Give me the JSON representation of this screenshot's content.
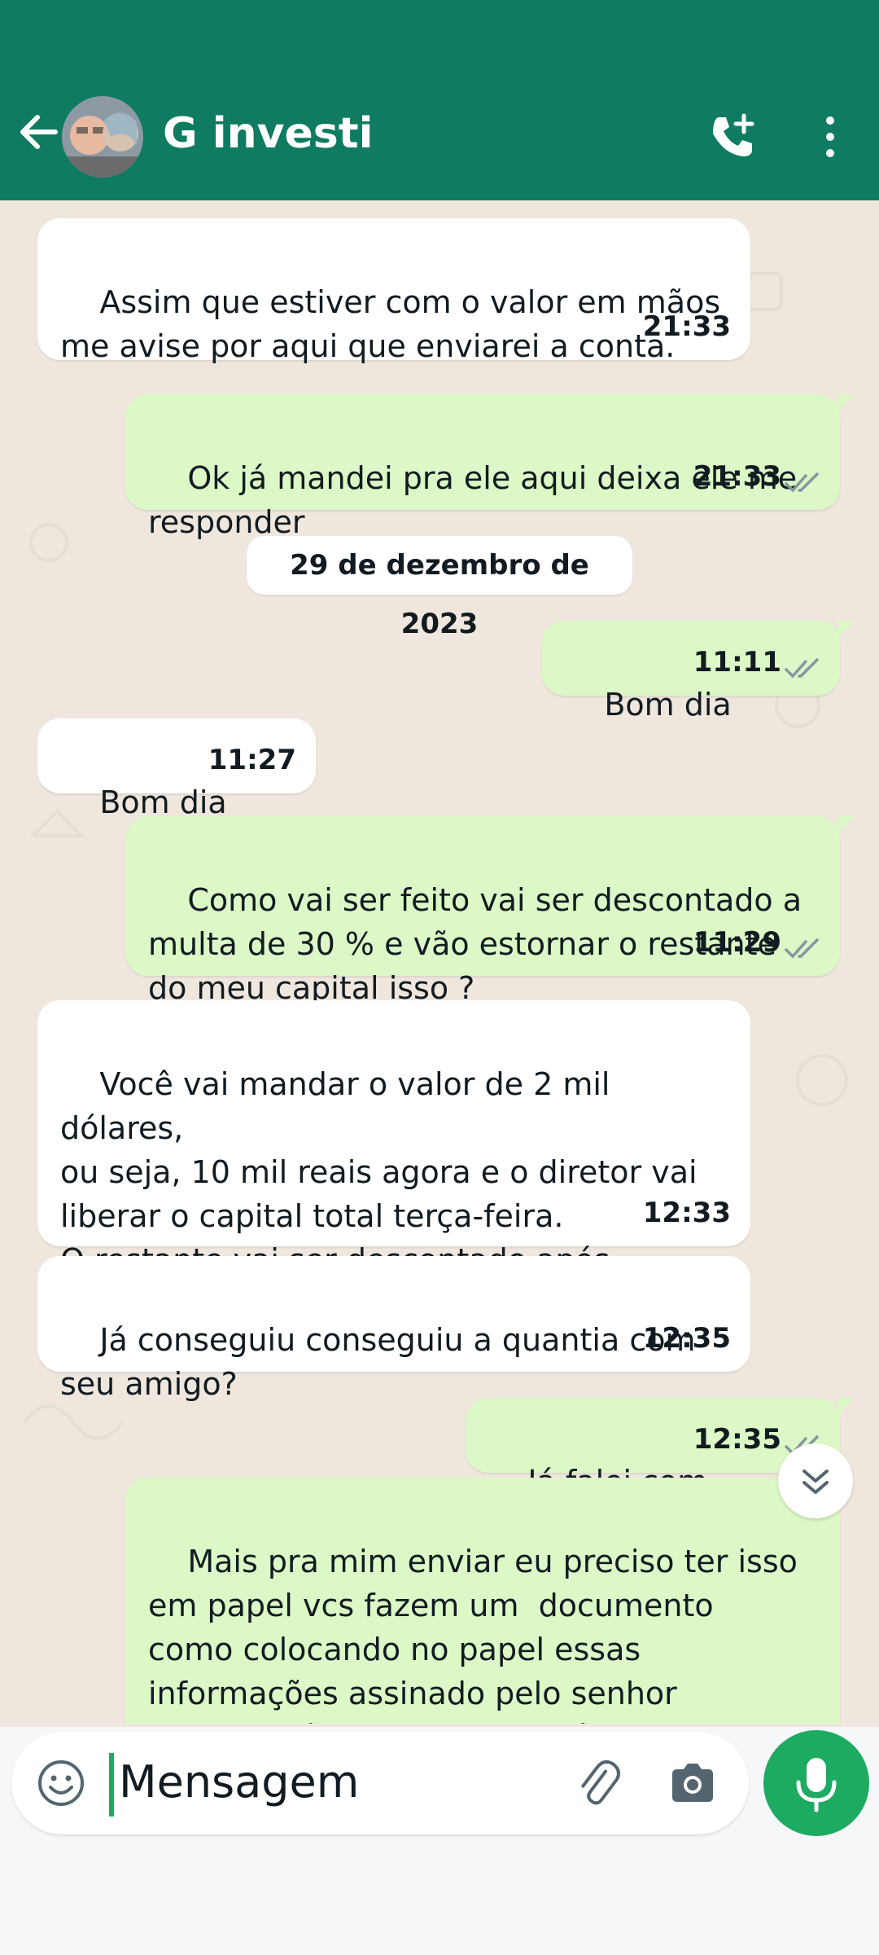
{
  "header": {
    "title": "G investi",
    "back_icon": "arrow-left-icon",
    "call_icon": "add-call-icon",
    "menu_icon": "more-vertical-icon",
    "bg_color": "#0f7b60"
  },
  "messages": [
    {
      "dir": "in",
      "text": "Assim que estiver com o valor em mãos\nme avise por aqui que enviarei a conta.",
      "time": "21:33"
    },
    {
      "dir": "out",
      "text": "Ok já mandei pra ele aqui deixa ele me\nresponder",
      "time": "21:33"
    },
    {
      "dir": "out",
      "text": "Bom dia",
      "time": "11:11"
    },
    {
      "dir": "in",
      "text": "Bom dia",
      "time": "11:27"
    },
    {
      "dir": "out",
      "text": "Como vai ser feito vai ser descontado a\nmulta de 30 % e vão estornar o restante\ndo meu capital isso ?",
      "time": "11:29"
    },
    {
      "dir": "in",
      "text": "Você vai mandar o valor de 2 mil dólares,\nou seja, 10 mil reais agora e o diretor vai\nliberar o capital total terça-feira.\nO restante vai ser descontado após",
      "time": "12:33"
    },
    {
      "dir": "in",
      "text": "Já conseguiu conseguiu a quantia com\nseu amigo?",
      "time": "12:35"
    },
    {
      "dir": "out",
      "text": "Já falei com",
      "time": "12:35"
    },
    {
      "dir": "out",
      "text": "Mais pra mim enviar eu preciso ter isso\nem papel vcs fazem um  documento\ncomo colocando no papel essas\ninformações assinado pelo senhor\ne responsável pelo responsável pela",
      "time": ""
    }
  ],
  "date_separator": "29 de dezembro de 2023",
  "composer": {
    "placeholder": "Mensagem",
    "emoji_icon": "emoji-icon",
    "attach_icon": "paperclip-icon",
    "camera_icon": "camera-icon",
    "mic_icon": "microphone-icon",
    "accent_color": "#1daa61"
  },
  "scroll_icon": "double-chevron-down-icon",
  "colors": {
    "incoming_bubble": "#ffffff",
    "outgoing_bubble": "#dcf8c6",
    "chat_bg": "#efe7dd",
    "read_ticks": "#8696a0"
  }
}
